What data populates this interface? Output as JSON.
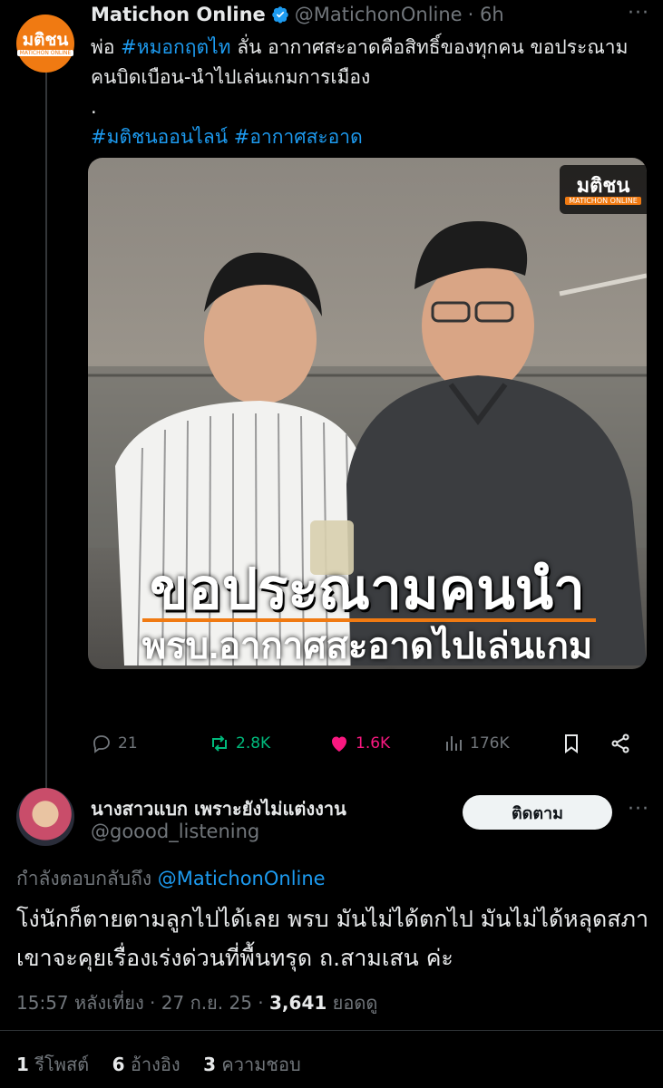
{
  "tweet": {
    "author_name": "Matichon Online",
    "handle": "@MatichonOnline",
    "time": "· 6h",
    "avatar_text": "มติชน",
    "avatar_subtext": "MATICHON ONLINE",
    "text_prefix": "พ่อ ",
    "text_hashtag1": "#หมอกฤตไท",
    "text_rest": " ลั่น อากาศสะอาดคือสิทธิ์ของทุกคน ขอประณามคนบิดเบือน-นำไปเล่นเกมการเมือง",
    "text_dot": ".",
    "hashtag2": "#มติชนออนไลน์",
    "hashtag3": "#อากาศสะอาด",
    "image": {
      "logo_text": "มติชน",
      "logo_sub": "MATICHON ONLINE",
      "caption_line1": "ขอประณามคนนำ",
      "caption_line2": "พรบ.อากาศสะอาดไปเล่นเกมการเมือง"
    },
    "stats": {
      "replies": "21",
      "retweets": "2.8K",
      "likes": "1.6K",
      "views": "176K"
    }
  },
  "reply": {
    "author_name": "นางสาวแบก เพราะยังไม่แต่งงาน",
    "handle": "@goood_listening",
    "follow_label": "ติดตาม",
    "replying_to_prefix": "กำลังตอบกลับถึง ",
    "replying_to_handle": "@MatichonOnline",
    "text": "โง่นักก็ตายตามลูกไปได้เลย พรบ มันไม่ได้ตกไป มันไม่ได้หลุดสภา เขาจะคุยเรื่องเร่งด่วนที่พื้นทรุด ถ.สามเสน ค่ะ",
    "timestamp": "15:57 หลังเที่ยง · 27 ก.ย. 25 · ",
    "views_count": "3,641",
    "views_label": " ยอดดู",
    "retweets_count": "1",
    "retweets_label": " รีโพสต์",
    "quotes_count": "6",
    "quotes_label": " อ้างอิง",
    "likes_count": "3",
    "likes_label": " ความชอบ"
  },
  "colors": {
    "background": "#000000",
    "link": "#1d9bf0",
    "secondary": "#71767b",
    "retweet_green": "#00ba7c",
    "like_pink": "#f91880",
    "brand_orange": "#f07a12"
  },
  "icons": [
    "verified-badge-icon",
    "more-icon",
    "reply-icon",
    "retweet-icon",
    "like-icon",
    "views-icon",
    "bookmark-icon",
    "share-icon"
  ]
}
